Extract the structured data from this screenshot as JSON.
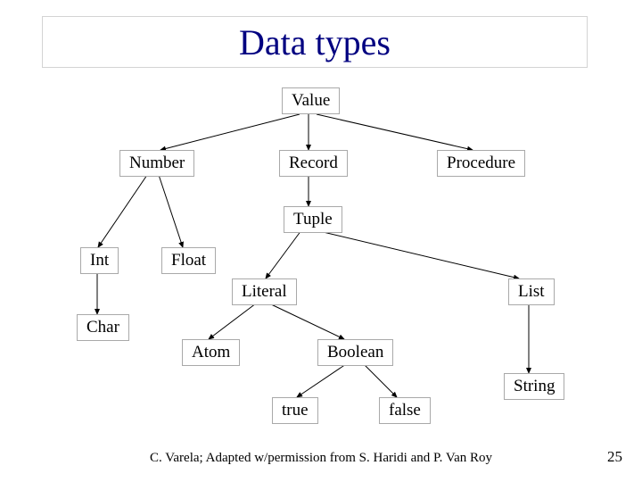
{
  "title": "Data types",
  "nodes": {
    "value": "Value",
    "number": "Number",
    "record": "Record",
    "procedure": "Procedure",
    "tuple": "Tuple",
    "int": "Int",
    "float": "Float",
    "literal": "Literal",
    "list": "List",
    "char": "Char",
    "atom": "Atom",
    "boolean": "Boolean",
    "string": "String",
    "true": "true",
    "false": "false"
  },
  "credit": "C. Varela; Adapted w/permission from S. Haridi and P. Van Roy",
  "pagenum": "25"
}
